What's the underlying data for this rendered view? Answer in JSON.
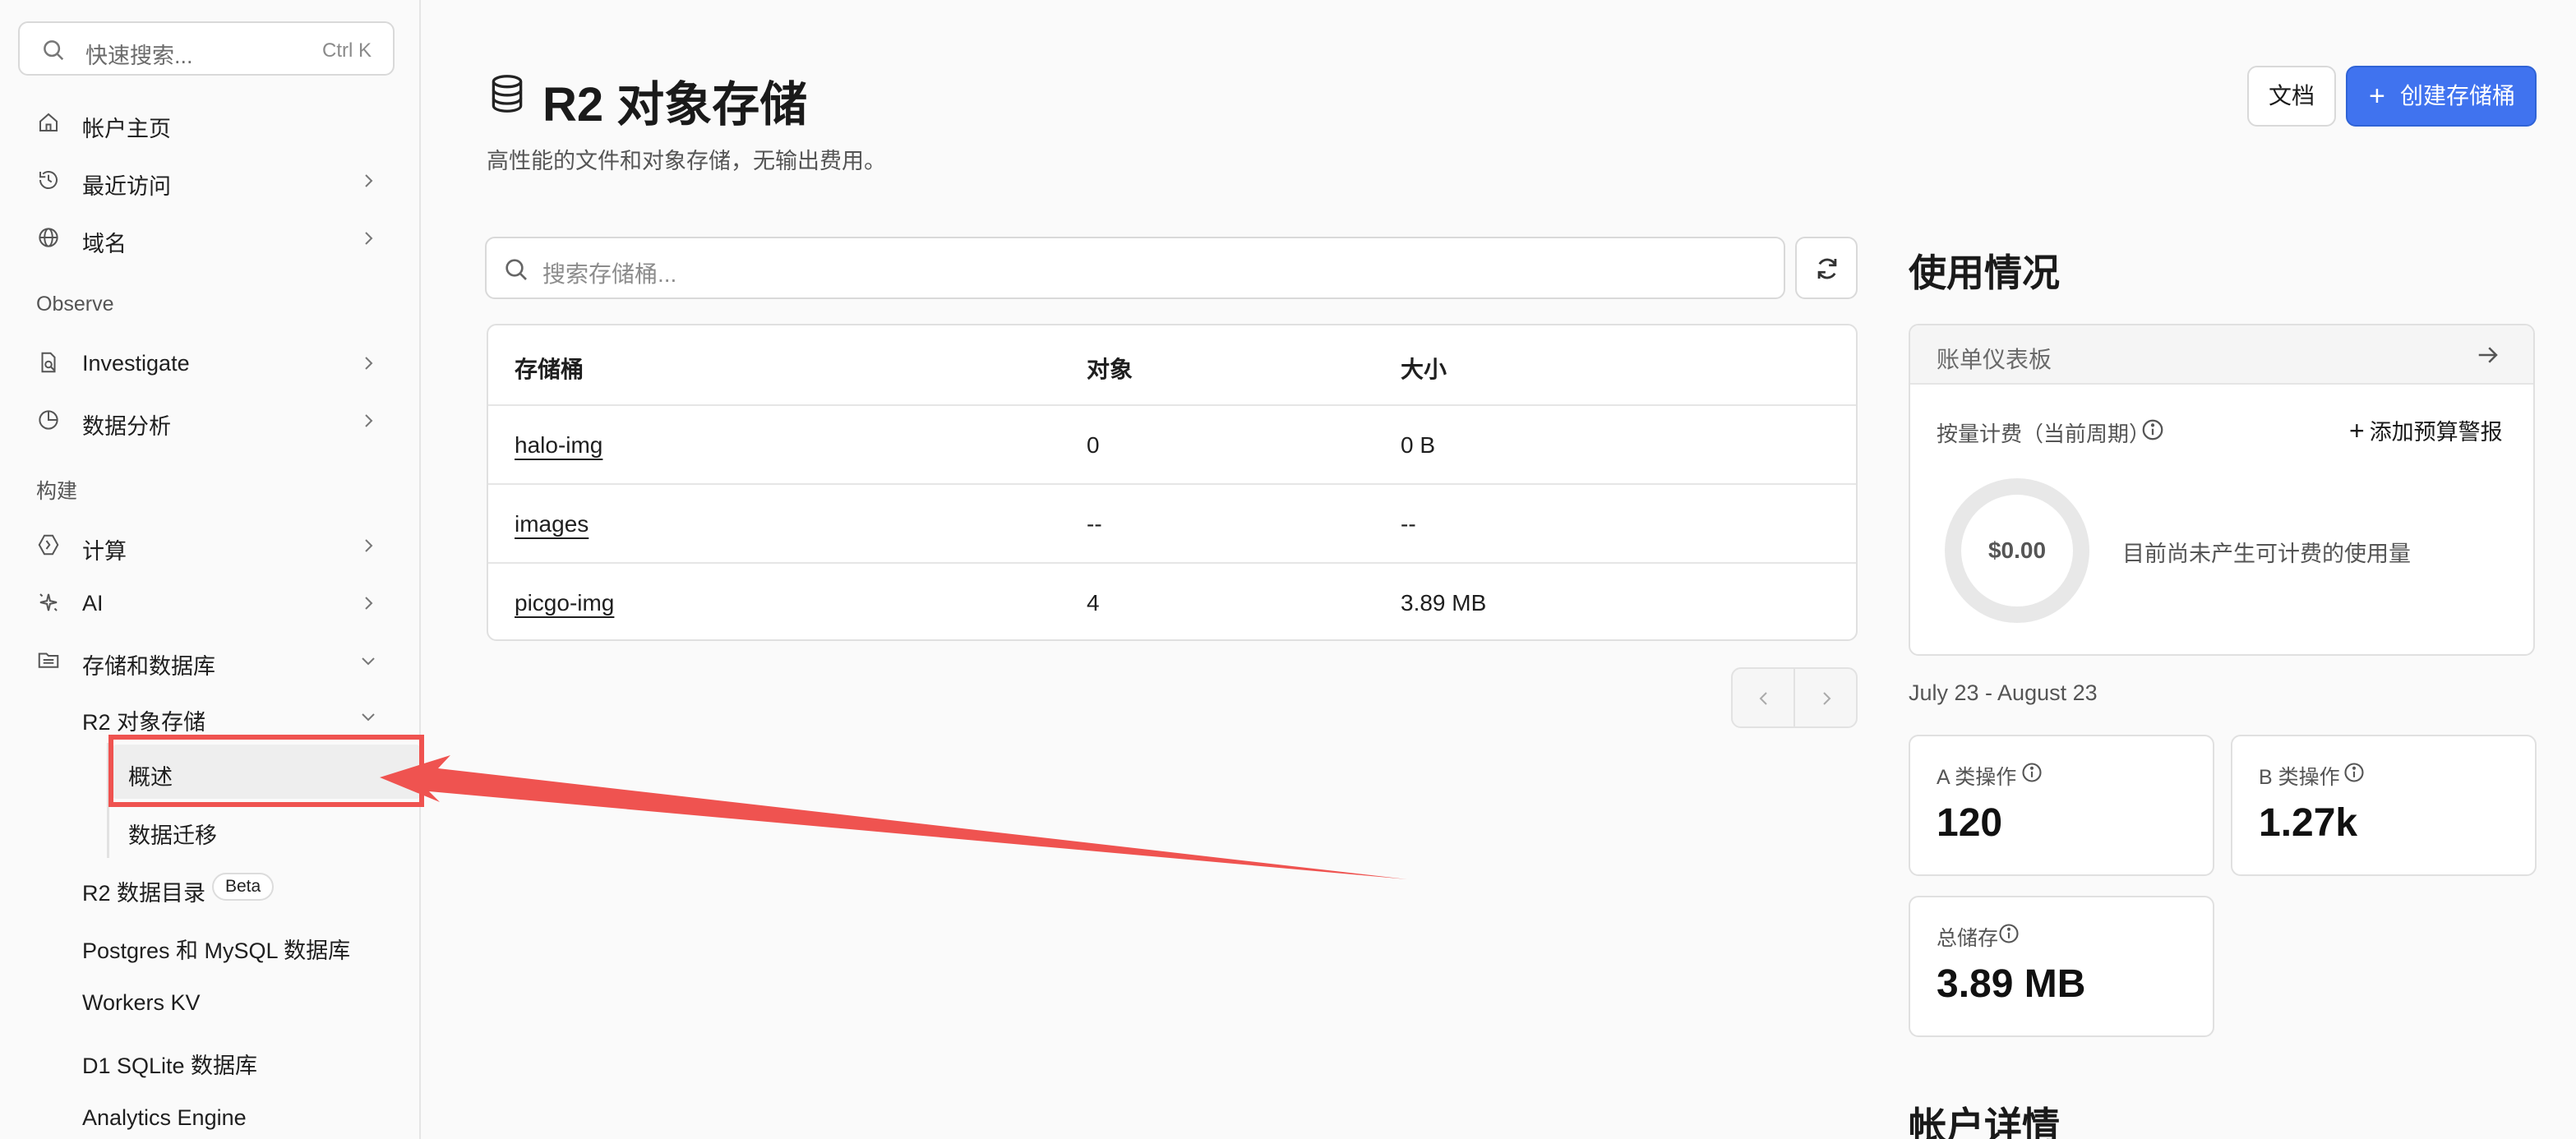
{
  "sidebar": {
    "search": {
      "placeholder": "快速搜索...",
      "shortcut": "Ctrl K"
    },
    "items": [
      {
        "label": "帐户主页",
        "icon": "home-icon"
      },
      {
        "label": "最近访问",
        "icon": "history-icon"
      },
      {
        "label": "域名",
        "icon": "globe-icon"
      }
    ],
    "observe": {
      "label": "Observe",
      "items": [
        {
          "label": "Investigate",
          "icon": "investigate-icon"
        },
        {
          "label": "数据分析",
          "icon": "analytics-icon"
        }
      ]
    },
    "build": {
      "label": "构建",
      "items": [
        {
          "label": "计算",
          "icon": "compute-icon"
        },
        {
          "label": "AI",
          "icon": "ai-sparkle-icon"
        },
        {
          "label": "存储和数据库",
          "icon": "storage-icon"
        }
      ]
    },
    "storage_children": {
      "r2": "R2 对象存储",
      "r2_children": [
        "概述",
        "数据迁移"
      ],
      "r2_catalog": "R2 数据目录",
      "beta": "Beta",
      "others": [
        "Postgres 和 MySQL 数据库",
        "Workers KV",
        "D1 SQLite 数据库",
        "Analytics Engine"
      ]
    }
  },
  "header": {
    "title": "R2 对象存储",
    "subtitle": "高性能的文件和对象存储，无输出费用。",
    "docs_button": "文档",
    "create_button": "创建存储桶"
  },
  "bucket_search": {
    "placeholder": "搜索存储桶..."
  },
  "table": {
    "columns": [
      "存储桶",
      "对象",
      "大小"
    ],
    "rows": [
      {
        "name": "halo-img",
        "objects": "0",
        "size": "0 B"
      },
      {
        "name": "images",
        "objects": "--",
        "size": "--"
      },
      {
        "name": "picgo-img",
        "objects": "4",
        "size": "3.89 MB"
      }
    ]
  },
  "usage": {
    "heading": "使用情况",
    "billing_dashboard": "账单仪表板",
    "payg_label": "按量计费（当前周期）",
    "add_budget_alert": "添加预算警报",
    "amount": "$0.00",
    "no_usage": "目前尚未产生可计费的使用量",
    "period": "July 23 - August 23",
    "stats": [
      {
        "label": "A 类操作",
        "value": "120"
      },
      {
        "label": "B 类操作",
        "value": "1.27k"
      },
      {
        "label": "总储存",
        "value": "3.89 MB"
      }
    ]
  },
  "account_heading": "帐户详情",
  "colors": {
    "primary": "#4073ef",
    "annotation": "#ef5350"
  }
}
